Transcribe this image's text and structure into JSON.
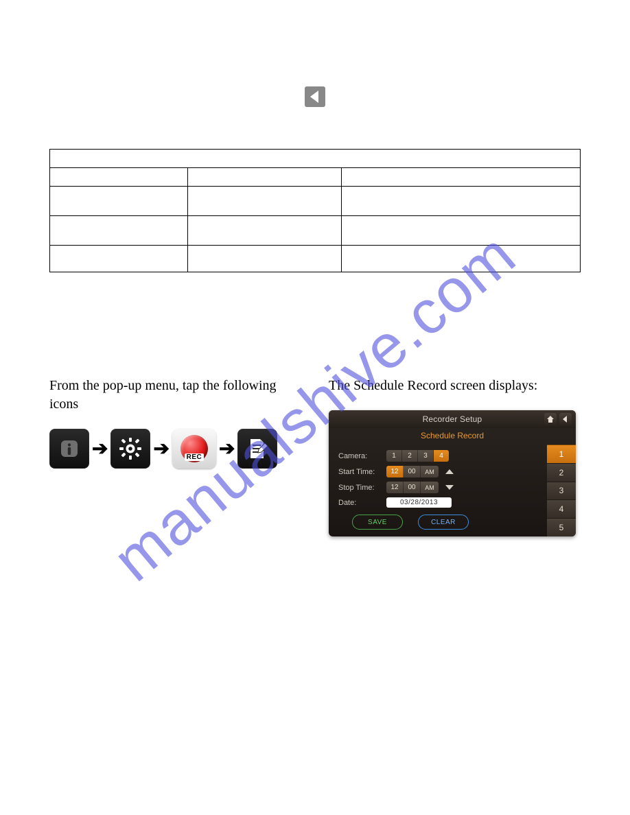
{
  "watermark": "manualshive.com",
  "left_text": "From the pop-up menu, tap the following icons",
  "right_text": "The Schedule Record screen displays:",
  "icon_labels": {
    "info": "info-icon",
    "gear": "gear-icon",
    "rec": "REC",
    "edit": "edit-doc-icon"
  },
  "recorder": {
    "title": "Recorder Setup",
    "subtitle": "Schedule Record",
    "camera_label": "Camera:",
    "camera_values": [
      "1",
      "2",
      "3",
      "4"
    ],
    "camera_selected": "4",
    "start_label": "Start Time:",
    "start_values": [
      "12",
      "00",
      "AM"
    ],
    "start_selected": "12",
    "stop_label": "Stop Time:",
    "stop_values": [
      "12",
      "00",
      "AM"
    ],
    "date_label": "Date:",
    "date_value": "03/28/2013",
    "save_label": "SAVE",
    "clear_label": "CLEAR",
    "side_tabs": [
      "1",
      "2",
      "3",
      "4",
      "5"
    ],
    "side_selected": "1"
  }
}
